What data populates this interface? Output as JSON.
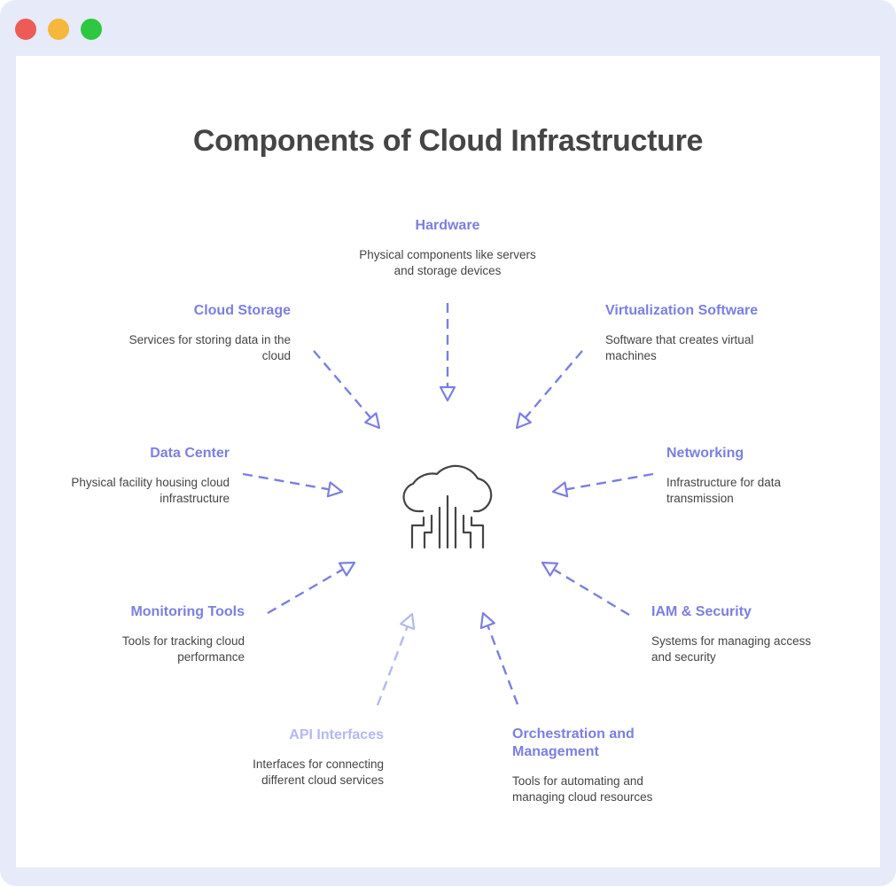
{
  "window": {
    "controls": [
      {
        "name": "close",
        "color": "#ee5b57"
      },
      {
        "name": "minimize",
        "color": "#f5b83d"
      },
      {
        "name": "zoom",
        "color": "#2ec740"
      }
    ]
  },
  "title": "Components of Cloud Infrastructure",
  "center_icon": "cloud-circuit-icon",
  "colors": {
    "accent": "#7b7fe0",
    "accent_light": "#b3b9f0",
    "text": "#444444",
    "window_background": "#e6eaf9"
  },
  "components": [
    {
      "id": "hardware",
      "title": "Hardware",
      "description": "Physical components like servers and storage devices",
      "color": "#7b7fe0"
    },
    {
      "id": "virtualization-software",
      "title": "Virtualization Software",
      "description": "Software that creates virtual machines",
      "color": "#7b7fe0"
    },
    {
      "id": "networking",
      "title": "Networking",
      "description": "Infrastructure for data transmission",
      "color": "#7b7fe0"
    },
    {
      "id": "iam-security",
      "title": "IAM & Security",
      "description": "Systems for managing access and security",
      "color": "#7b7fe0"
    },
    {
      "id": "orchestration-management",
      "title": "Orchestration and Management",
      "description": "Tools for automating and managing cloud resources",
      "color": "#7b7fe0"
    },
    {
      "id": "api-interfaces",
      "title": "API Interfaces",
      "description": "Interfaces for connecting different cloud services",
      "color": "#b3b9f0"
    },
    {
      "id": "monitoring-tools",
      "title": "Monitoring Tools",
      "description": "Tools for tracking cloud performance",
      "color": "#7b7fe0"
    },
    {
      "id": "data-center",
      "title": "Data Center",
      "description": "Physical facility housing cloud infrastructure",
      "color": "#7b7fe0"
    },
    {
      "id": "cloud-storage",
      "title": "Cloud Storage",
      "description": "Services for storing data in the cloud",
      "color": "#7b7fe0"
    }
  ]
}
